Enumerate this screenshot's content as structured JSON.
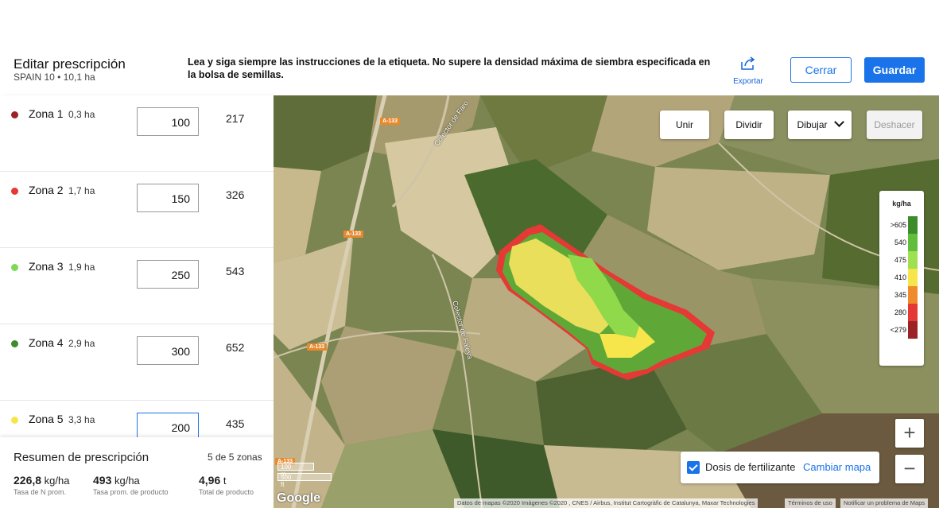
{
  "header": {
    "title": "Editar prescripción",
    "subtitle": "SPAIN 10 • 10,1 ha",
    "notice": "Lea y siga siempre las instrucciones de la etiqueta. No supere la densidad máxima de siembra especificada en la bolsa de semillas.",
    "export_label": "Exportar",
    "export_icon": "share-export-icon",
    "close_label": "Cerrar",
    "save_label": "Guardar"
  },
  "zones": [
    {
      "name": "Zona 1",
      "area": "0,3 ha",
      "rate": "100",
      "product": "217",
      "color": "#9b2226"
    },
    {
      "name": "Zona 2",
      "area": "1,7 ha",
      "rate": "150",
      "product": "326",
      "color": "#e53935"
    },
    {
      "name": "Zona 3",
      "area": "1,9 ha",
      "rate": "250",
      "product": "543",
      "color": "#7ed957"
    },
    {
      "name": "Zona 4",
      "area": "2,9 ha",
      "rate": "300",
      "product": "652",
      "color": "#3d8b2a"
    },
    {
      "name": "Zona 5",
      "area": "3,3 ha",
      "rate": "200",
      "product": "435",
      "color": "#f6e64b"
    }
  ],
  "summary": {
    "title": "Resumen de prescripción",
    "count": "5 de 5 zonas",
    "stats": [
      {
        "value": "226,8",
        "unit": "kg/ha",
        "label": "Tasa de N prom."
      },
      {
        "value": "493",
        "unit": "kg/ha",
        "label": "Tasa prom. de producto"
      },
      {
        "value": "4,96",
        "unit": "t",
        "label": "Total de producto"
      }
    ]
  },
  "map": {
    "tools": {
      "merge": "Unir",
      "split": "Dividir",
      "draw": "Dibujar",
      "undo": "Deshacer"
    },
    "legend": {
      "unit": "kg/ha",
      "items": [
        {
          "label": ">605",
          "color": "#3d8b2a"
        },
        {
          "label": "540",
          "color": "#5fbf3a"
        },
        {
          "label": "475",
          "color": "#9ee04f"
        },
        {
          "label": "410",
          "color": "#f6e64b"
        },
        {
          "label": "345",
          "color": "#f08a2e"
        },
        {
          "label": "280",
          "color": "#e53935"
        },
        {
          "label": "<279",
          "color": "#9b2226"
        }
      ]
    },
    "zoom_in": "+",
    "zoom_out": "−",
    "layer_toggle_label": "Dosis de fertilizante",
    "layer_toggle_checked": true,
    "change_map_label": "Cambiar mapa",
    "scale": {
      "metric": "100 m",
      "imperial": "500 ft"
    },
    "logo": "Google",
    "attribution": "Datos de mapas ©2020 Imágenes ©2020 , CNES / Airbus, Institut Cartogràfic de Catalunya, Maxar Technologies",
    "terms": "Términos de uso",
    "report": "Notificar un problema de Maps",
    "roads": [
      "A-133",
      "A-133",
      "A-133",
      "A-133"
    ],
    "place_labels": [
      "Colector de Faro",
      "Colector de Faleya"
    ]
  }
}
